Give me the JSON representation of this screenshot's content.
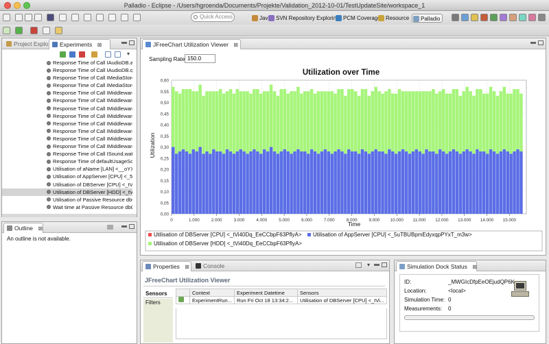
{
  "window": {
    "title": "Palladio - Eclipse - /Users/hgroenda/Documents/Projekte/Validation_2012-10-01/TestUpdateSite/workspace_1"
  },
  "toolbar": {
    "quick_access_placeholder": "Quick Access",
    "perspectives": [
      {
        "label": "Java",
        "color": "#c48a3a"
      },
      {
        "label": "SVN Repository Exploring",
        "color": "#8a6fbf"
      },
      {
        "label": "PCM Coverage",
        "color": "#3b7fbf"
      },
      {
        "label": "Resource",
        "color": "#c9a33a"
      },
      {
        "label": "Palladio",
        "color": "#7f9fbf"
      }
    ]
  },
  "left_top": {
    "tabs": [
      {
        "label": "Project Explo"
      },
      {
        "label": "Experiments",
        "close": "⊠"
      }
    ],
    "tree_items": [
      "Response Time of Call IAudioDB.ad",
      "Response Time of Call IAudioDB.q",
      "Response Time of Call IMediaStore",
      "Response Time of Call IMediaStore",
      "Response Time of Call IMiddleware",
      "Response Time of Call IMiddleware",
      "Response Time of Call IMiddleware",
      "Response Time of Call IMiddleware",
      "Response Time of Call IMiddleware",
      "Response Time of Call IMiddleware",
      "Response Time of Call IMiddleware",
      "Response Time of Call IMiddleware",
      "Response Time of Call ISound.wat",
      "Response Time of defaultUsageSce",
      "Utilisation of aName [LAN] <__oYX",
      "Utilisation of AppServer [CPU] <_5",
      "Utilisation of DBServer [CPU] <_tVi",
      "Utilisation of DBServer [HDD] <_tV",
      "Utilisation of Passive Resource dbC",
      "Wait time at Passive Resource dbC"
    ],
    "selected_index": 17
  },
  "outline": {
    "tab": "Outline",
    "close": "⊠",
    "message": "An outline is not available."
  },
  "editor": {
    "tab": "JFreeChart Utilization Viewer",
    "close": "⊠",
    "sampling_label": "Sampling Rate",
    "sampling_value": "150.0"
  },
  "chart_data": {
    "type": "bar",
    "title": "Utilization over Time",
    "xlabel": "Time",
    "ylabel": "Utilization",
    "ylim": [
      0,
      0.6
    ],
    "xlim": [
      0,
      15750
    ],
    "y_ticks": [
      "0,00",
      "0,05",
      "0,10",
      "0,15",
      "0,20",
      "0,25",
      "0,30",
      "0,35",
      "0,40",
      "0,45",
      "0,50",
      "0,55",
      "0,60"
    ],
    "x_ticks": [
      "0",
      "1.000",
      "2.000",
      "3.000",
      "4.000",
      "5.000",
      "6.000",
      "7.000",
      "8.000",
      "9.000",
      "10.000",
      "11.000",
      "12.000",
      "13.000",
      "14.000",
      "15.000"
    ],
    "x_tick_values": [
      0,
      1000,
      2000,
      3000,
      4000,
      5000,
      6000,
      7000,
      8000,
      9000,
      10000,
      11000,
      12000,
      13000,
      14000,
      15000
    ],
    "bin_width": 150,
    "grid": true,
    "legend_position": "bottom",
    "series": [
      {
        "name": "Utilisation of DBServer [CPU] <_tVi40Dq_EeCCbpF63PflyA>",
        "color": "#f04a4a",
        "values": [
          0
        ]
      },
      {
        "name": "Utilisation of AppServer [CPU] <_5uTBUBpmEdyxqpPYxT_m3w>",
        "color": "#5b6ee6",
        "values": [
          0.3,
          0.27,
          0.28,
          0.29,
          0.28,
          0.27,
          0.29,
          0.28,
          0.3,
          0.27,
          0.28,
          0.27,
          0.29,
          0.28,
          0.28,
          0.27,
          0.29,
          0.28,
          0.27,
          0.28,
          0.29,
          0.28,
          0.27,
          0.28,
          0.29,
          0.28,
          0.27,
          0.29,
          0.28,
          0.3,
          0.28,
          0.27,
          0.28,
          0.29,
          0.28,
          0.27,
          0.28,
          0.29,
          0.28,
          0.28,
          0.27,
          0.29,
          0.28,
          0.27,
          0.28,
          0.29,
          0.28,
          0.27,
          0.28,
          0.29,
          0.28,
          0.27,
          0.29,
          0.28,
          0.28,
          0.27,
          0.29,
          0.28,
          0.27,
          0.28,
          0.29,
          0.28,
          0.28,
          0.27,
          0.29,
          0.28,
          0.27,
          0.28,
          0.29,
          0.28,
          0.27,
          0.28,
          0.29,
          0.28,
          0.27,
          0.29,
          0.28,
          0.28,
          0.27,
          0.29,
          0.28,
          0.27,
          0.28,
          0.29,
          0.28,
          0.27,
          0.28,
          0.29,
          0.28,
          0.27,
          0.29,
          0.28,
          0.28,
          0.27,
          0.29,
          0.28,
          0.27,
          0.28,
          0.29,
          0.28,
          0.27,
          0.28,
          0.29,
          0.28
        ]
      },
      {
        "name": "Utilisation of DBServer [HDD] <_tVi40Dq_EeCCbpF63PflyA>",
        "color": "#a6f57a",
        "values": [
          0.27,
          0.28,
          0.26,
          0.27,
          0.28,
          0.29,
          0.26,
          0.27,
          0.28,
          0.26,
          0.27,
          0.28,
          0.26,
          0.27,
          0.28,
          0.27,
          0.26,
          0.28,
          0.27,
          0.28,
          0.26,
          0.27,
          0.28,
          0.26,
          0.27,
          0.28,
          0.27,
          0.26,
          0.27,
          0.28,
          0.27,
          0.26,
          0.28,
          0.27,
          0.26,
          0.28,
          0.27,
          0.28,
          0.26,
          0.27,
          0.28,
          0.27,
          0.26,
          0.28,
          0.27,
          0.26,
          0.27,
          0.28,
          0.26,
          0.27,
          0.28,
          0.26,
          0.27,
          0.28,
          0.27,
          0.26,
          0.27,
          0.28,
          0.26,
          0.27,
          0.28,
          0.27,
          0.26,
          0.28,
          0.27,
          0.26,
          0.27,
          0.28,
          0.26,
          0.27,
          0.28,
          0.27,
          0.26,
          0.27,
          0.28,
          0.26,
          0.27,
          0.28,
          0.27,
          0.26,
          0.28,
          0.27,
          0.26,
          0.27,
          0.28,
          0.26,
          0.27,
          0.28,
          0.27,
          0.26,
          0.27,
          0.28,
          0.26,
          0.27,
          0.28,
          0.27,
          0.26,
          0.27,
          0.28,
          0.26,
          0.27,
          0.28,
          0.27,
          0.26,
          0.27
        ]
      }
    ]
  },
  "properties": {
    "tabs": [
      {
        "label": "Properties",
        "close": "⊠"
      },
      {
        "label": "Console"
      }
    ],
    "heading": "JFreeChart Utilization Viewer",
    "side_tabs": [
      "Sensors",
      "Filters"
    ],
    "columns": [
      "",
      "Context",
      "Experiment Datetime",
      "Sensors"
    ],
    "rows": [
      {
        "context": "ExperimentRun...",
        "datetime": "Run Fri Oct 18 13:34:2...",
        "sensors": "Utilisation of DBServer [CPU] <_tVi..."
      }
    ]
  },
  "dock": {
    "tab": "Simulation Dock Status",
    "close": "⊠",
    "fields": [
      {
        "label": "ID:",
        "value": "_MWGIcDfpEeOEjudQP6K"
      },
      {
        "label": "Location:",
        "value": "<local>"
      },
      {
        "label": "Simulation Time:",
        "value": "0"
      },
      {
        "label": "Measurements:",
        "value": "0"
      }
    ]
  }
}
